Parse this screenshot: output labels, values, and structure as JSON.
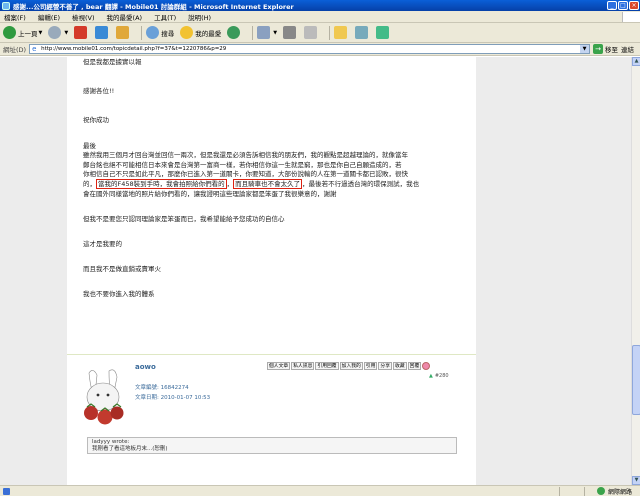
{
  "window": {
    "title": "感謝...公司經營不善了 , bear 翻譯 - Mobile01 討論群組 - Microsoft Internet Explorer"
  },
  "menu": [
    "檔案(F)",
    "編輯(E)",
    "檢視(V)",
    "我的最愛(A)",
    "工具(T)",
    "說明(H)"
  ],
  "toolbar": {
    "back_label": "上一頁",
    "search_label": "搜尋",
    "favorites_label": "我的最愛"
  },
  "address": {
    "label": "網址(D)",
    "url": "http://www.mobile01.com/topicdetail.php?f=37&t=1220786&p=29",
    "go_label": "移至",
    "links_label": "連結"
  },
  "post": {
    "lines": [
      "但是我都是據實以報",
      "",
      "感謝各位!!",
      "",
      "祝你成功",
      "",
      "最後",
      "雖然我用三個月才回台灣並回信一兩次，但是我還是必須告訴相信我的朋友們，我的觀點是超越理論的，就像當年",
      "鄭台銘也絕不可能相信日本來會是台灣第一富商一樣，若你相信你這一生就是窮，那也是你自己自願造成的，若",
      "你相信自己不只是如此平凡，那麼你已進入第一道關卡，你要知道，大部份說輸的人在第一道關卡都已認敗，很快"
    ],
    "line_hl_before": "的，",
    "line_hl1": "當我的F458裝到手時，我會拍照給你們看的",
    "line_hl_mid": "，",
    "line_hl2": "而且騎車也不會太久了",
    "line_hl_after": "，最後若不行過透台灣的環保測試，我也",
    "lines2": [
      "會在國外同樣當地的照片給你們看的，讓我證明這些理論家都是笨蛋了我很樂意的，謝謝",
      "",
      "但我不是要您只認同理論家是笨蛋而已，我希望能給予您成功的自信心",
      "",
      "這才是我要的",
      "",
      "而且我不是做直銷或賣軍火",
      "",
      "我也不要你進入我的體系"
    ]
  },
  "author": {
    "name": "aowo",
    "posts_label": "文章編號:",
    "posts_value": "16842274",
    "date_label": "文章日期:",
    "date_value": "2010-01-07 10:53",
    "buttons": [
      "個人文章",
      "私人訊息",
      "引用回覆",
      "加入我的",
      "引用",
      "分享",
      "收藏",
      "回覆"
    ],
    "floor": "#280"
  },
  "quote": {
    "author": "ladyyy wrote:",
    "text": "我剛看了看這地板月末...(恕刪)"
  },
  "status": {
    "zone": "網際網路"
  }
}
